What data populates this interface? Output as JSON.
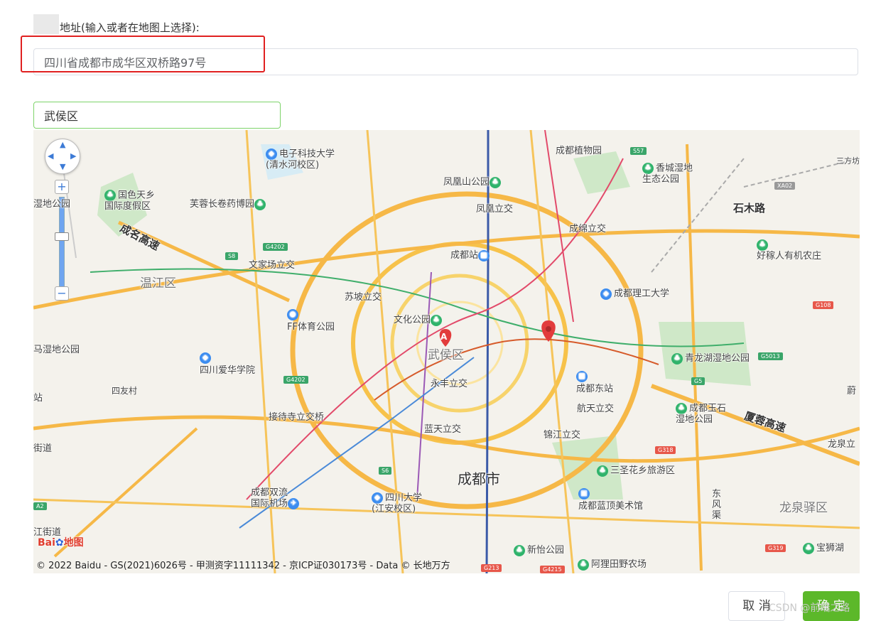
{
  "form": {
    "address_label": "地址(输入或者在地图上选择):",
    "address_value": "四川省成都市成华区双桥路97号",
    "search_value": "武侯区"
  },
  "map": {
    "labels": {
      "l1": "电子科技大学\n(清水河校区)",
      "l2": "成都植物园",
      "l3": "凤凰山公园",
      "l4": "香城湿地\n生态公园",
      "l5": "国色天乡\n国际度假区",
      "l6": "芙蓉长卷药博园",
      "l7": "凤凰立交",
      "l8": "石木路",
      "l9": "成绵立交",
      "l10": "成名高速",
      "l11": "成都站",
      "l12": "文家场立交",
      "l13": "好稼人有机农庄",
      "l14": "温江区",
      "l15": "苏坡立交",
      "l16": "成都理工大学",
      "l17": "文化公园",
      "l18": "FF体育公园",
      "l19": "武侯区",
      "l20": "马湿地公园",
      "l21": "青龙湖湿地公园",
      "l22": "四川爱华学院",
      "l23": "永丰立交",
      "l24": "成都东站",
      "l25": "四友村",
      "l26": "航天立交",
      "l27": "成都玉石\n湿地公园",
      "l28": "厦蓉高速",
      "l29": "接待寺立交桥",
      "l30": "蓝天立交",
      "l31": "锦江立交",
      "l32": "龙泉立",
      "l33": "街道",
      "l34": "成都市",
      "l35": "三圣花乡旅游区",
      "l36": "成都双流\n国际机场",
      "l37": "四川大学\n(江安校区)",
      "l38": "成都蓝顶美术馆",
      "l39": "龙泉驿区",
      "l40": "东风渠",
      "l41": "江街道",
      "l42": "新怡公园",
      "l43": "阿狸田野农场",
      "l44": "宝狮湖",
      "l45": "三方坊",
      "l46": "站",
      "l47": "湿地公园",
      "l48": "蔚"
    },
    "shields": [
      "S57",
      "XA02",
      "G4202",
      "S8",
      "G108",
      "G5013",
      "G4202",
      "G5",
      "G318",
      "S6",
      "G4215",
      "G213",
      "G319",
      "A2"
    ],
    "marker_letter": "A",
    "copyright": "© 2022 Baidu - GS(2021)6026号 - 甲测资字11111342 - 京ICP证030173号 - Data © 长地万方",
    "logo_bai": "Bai",
    "logo_du": "地图",
    "zoom_in": "+",
    "zoom_out": "−"
  },
  "buttons": {
    "cancel": "取 消",
    "ok": "确 定"
  },
  "watermark": "CSDN @前端之路",
  "colors": {
    "accent_green": "#5cb82a",
    "highlight_red": "#e02020",
    "search_border": "#7ed36a"
  }
}
